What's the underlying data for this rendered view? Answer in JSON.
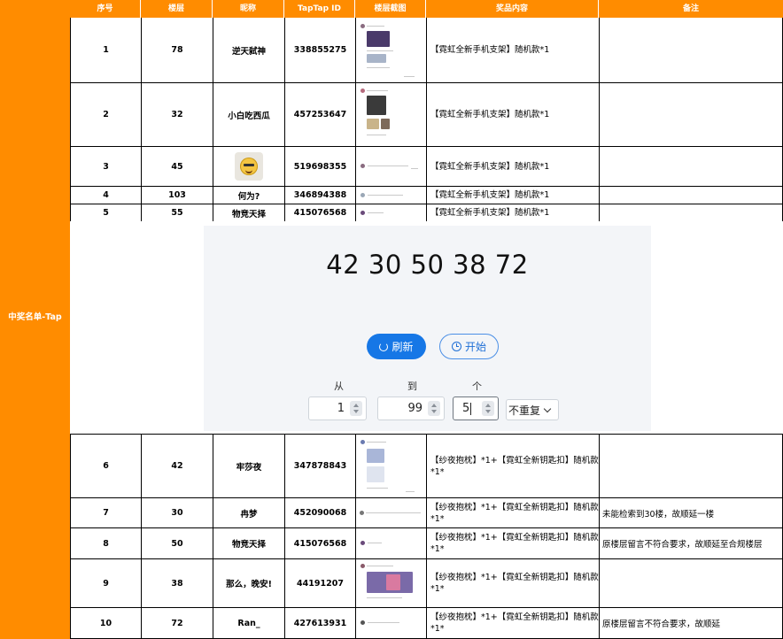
{
  "section_label": "中奖名单-Tap",
  "headers": {
    "index": "序号",
    "floor": "楼层",
    "nickname": "昵称",
    "taptap_id": "TapTap ID",
    "screenshot": "楼层截图",
    "prize": "奖品内容",
    "note": "备注"
  },
  "rows_top": [
    {
      "index": "1",
      "floor": "78",
      "nickname": "逆天弑神",
      "taptap_id": "338855275",
      "prize": "【霓虹全新手机支架】随机款*1",
      "note": ""
    },
    {
      "index": "2",
      "floor": "32",
      "nickname": "小白吃西瓜",
      "taptap_id": "457253647",
      "prize": "【霓虹全新手机支架】随机款*1",
      "note": ""
    },
    {
      "index": "3",
      "floor": "45",
      "nickname": "",
      "taptap_id": "519698355",
      "prize": "【霓虹全新手机支架】随机款*1",
      "note": ""
    },
    {
      "index": "4",
      "floor": "103",
      "nickname": "何为?",
      "taptap_id": "346894388",
      "prize": "【霓虹全新手机支架】随机款*1",
      "note": ""
    },
    {
      "index": "5",
      "floor": "55",
      "nickname": "物竞天择",
      "taptap_id": "415076568",
      "prize": "【霓虹全新手机支架】随机款*1",
      "note": ""
    }
  ],
  "picker": {
    "numbers": "42 30 50 38 72",
    "refresh_label": "刷新",
    "start_label": "开始",
    "from_label": "从",
    "to_label": "到",
    "count_label": "个",
    "from_value": "1",
    "to_value": "99",
    "count_value": "5",
    "repeat_option": "不重复"
  },
  "rows_bottom": [
    {
      "index": "6",
      "floor": "42",
      "nickname": "牢莎夜",
      "taptap_id": "347878843",
      "prize": "【纱夜抱枕】*1+【霓虹全新钥匙扣】随机款*1*",
      "note": ""
    },
    {
      "index": "7",
      "floor": "30",
      "nickname": "冉梦",
      "taptap_id": "452090068",
      "prize": "【纱夜抱枕】*1+【霓虹全新钥匙扣】随机款*1*",
      "note": "未能检索到30楼，故顺延一楼"
    },
    {
      "index": "8",
      "floor": "50",
      "nickname": "物竞天择",
      "taptap_id": "415076568",
      "prize": "【纱夜抱枕】*1+【霓虹全新钥匙扣】随机款*1*",
      "note": "原楼层留言不符合要求，故顺延至合规楼层"
    },
    {
      "index": "9",
      "floor": "38",
      "nickname": "那么，晚安!",
      "taptap_id": "44191207",
      "prize": "【纱夜抱枕】*1+【霓虹全新钥匙扣】随机款*1*",
      "note": ""
    },
    {
      "index": "10",
      "floor": "72",
      "nickname": "Ran_",
      "taptap_id": "427613931",
      "prize": "【纱夜抱枕】*1+【霓虹全新钥匙扣】随机款*1*",
      "note": "原楼层留言不符合要求，故顺延"
    }
  ],
  "icons": {
    "refresh": "refresh-icon",
    "start": "clock-icon",
    "avatar": "emoji-avatar-icon"
  },
  "colors": {
    "accent_orange": "#ff8c00",
    "button_blue": "#1677e6"
  }
}
